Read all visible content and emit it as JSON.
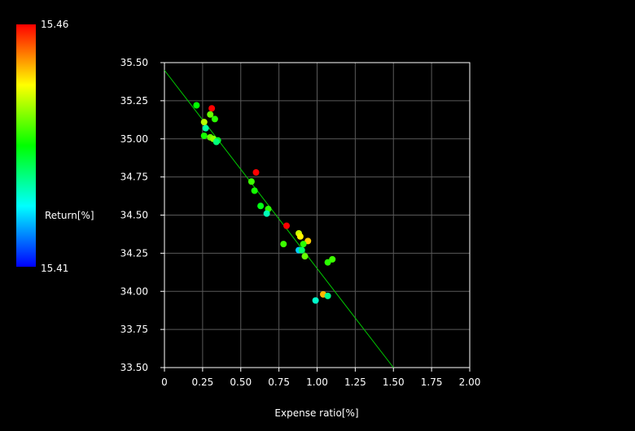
{
  "chart_data": {
    "type": "scatter",
    "title": "",
    "xlabel": "Expense ratio[%]",
    "ylabel": "",
    "xlim": [
      0,
      2.0
    ],
    "ylim": [
      33.5,
      35.5
    ],
    "xticks": [
      "0",
      "0.25",
      "0.50",
      "0.75",
      "1.00",
      "1.25",
      "1.50",
      "1.75",
      "2.00"
    ],
    "yticks": [
      "33.50",
      "33.75",
      "34.00",
      "34.25",
      "34.50",
      "34.75",
      "35.00",
      "35.25",
      "35.50"
    ],
    "grid": true,
    "colorbar": {
      "label": "Return[%]",
      "max_label": "15.46",
      "min_label": "15.41",
      "min": 15.41,
      "max": 15.46
    },
    "trendline": {
      "x": [
        0,
        1.5
      ],
      "y": [
        35.45,
        33.5
      ],
      "color": "#00cc00"
    },
    "points": [
      {
        "x": 0.21,
        "y": 35.22,
        "c": 15.435
      },
      {
        "x": 0.31,
        "y": 35.2,
        "c": 15.46
      },
      {
        "x": 0.3,
        "y": 35.16,
        "c": 15.44
      },
      {
        "x": 0.33,
        "y": 35.13,
        "c": 15.437
      },
      {
        "x": 0.26,
        "y": 35.11,
        "c": 15.444
      },
      {
        "x": 0.27,
        "y": 35.07,
        "c": 15.427
      },
      {
        "x": 0.26,
        "y": 35.02,
        "c": 15.436
      },
      {
        "x": 0.3,
        "y": 35.01,
        "c": 15.44
      },
      {
        "x": 0.32,
        "y": 35.0,
        "c": 15.442
      },
      {
        "x": 0.35,
        "y": 34.99,
        "c": 15.433
      },
      {
        "x": 0.34,
        "y": 34.98,
        "c": 15.429
      },
      {
        "x": 0.6,
        "y": 34.78,
        "c": 15.46
      },
      {
        "x": 0.57,
        "y": 34.72,
        "c": 15.438
      },
      {
        "x": 0.59,
        "y": 34.66,
        "c": 15.436
      },
      {
        "x": 0.63,
        "y": 34.56,
        "c": 15.434
      },
      {
        "x": 0.68,
        "y": 34.54,
        "c": 15.437
      },
      {
        "x": 0.67,
        "y": 34.51,
        "c": 15.426
      },
      {
        "x": 0.8,
        "y": 34.43,
        "c": 15.46
      },
      {
        "x": 0.88,
        "y": 34.38,
        "c": 15.445
      },
      {
        "x": 0.89,
        "y": 34.36,
        "c": 15.448
      },
      {
        "x": 0.94,
        "y": 34.33,
        "c": 15.45
      },
      {
        "x": 0.78,
        "y": 34.31,
        "c": 15.438
      },
      {
        "x": 0.91,
        "y": 34.31,
        "c": 15.437
      },
      {
        "x": 0.88,
        "y": 34.27,
        "c": 15.42
      },
      {
        "x": 0.9,
        "y": 34.27,
        "c": 15.43
      },
      {
        "x": 0.92,
        "y": 34.23,
        "c": 15.44
      },
      {
        "x": 1.1,
        "y": 34.21,
        "c": 15.438
      },
      {
        "x": 1.07,
        "y": 34.19,
        "c": 15.437
      },
      {
        "x": 1.04,
        "y": 33.98,
        "c": 15.451
      },
      {
        "x": 1.07,
        "y": 33.97,
        "c": 15.428
      },
      {
        "x": 0.99,
        "y": 33.94,
        "c": 15.425
      }
    ]
  }
}
